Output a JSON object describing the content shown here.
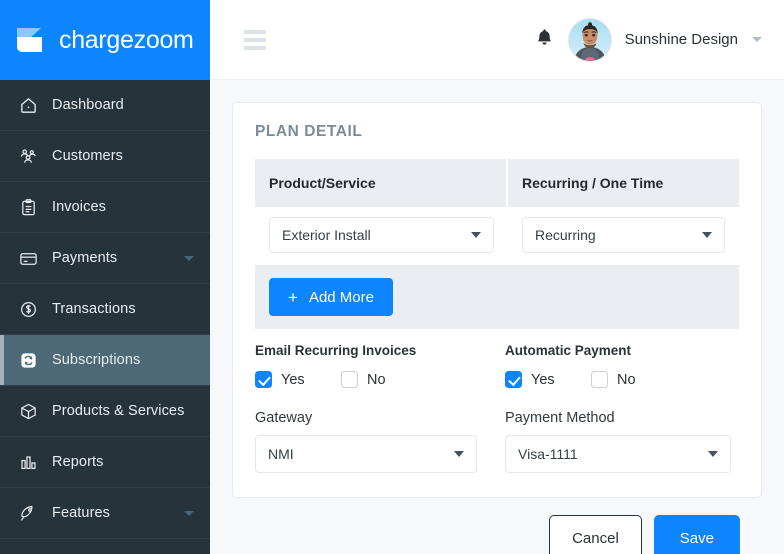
{
  "brand": {
    "name": "chargezoom",
    "logo_icon": "chargezoom-logo-icon",
    "bg_color": "#0d85fd"
  },
  "sidebar": {
    "bg_color": "#26333b",
    "active_bg_color": "#4d6876",
    "items": [
      {
        "label": "Dashboard",
        "icon": "home-icon",
        "active": false,
        "expandable": false
      },
      {
        "label": "Customers",
        "icon": "people-icon",
        "active": false,
        "expandable": false
      },
      {
        "label": "Invoices",
        "icon": "clipboard-icon",
        "active": false,
        "expandable": false
      },
      {
        "label": "Payments",
        "icon": "credit-card-icon",
        "active": false,
        "expandable": true
      },
      {
        "label": "Transactions",
        "icon": "dollar-circle-icon",
        "active": false,
        "expandable": false
      },
      {
        "label": "Subscriptions",
        "icon": "refresh-box-icon",
        "active": true,
        "expandable": false
      },
      {
        "label": "Products & Services",
        "icon": "box-icon",
        "active": false,
        "expandable": false
      },
      {
        "label": "Reports",
        "icon": "bar-chart-icon",
        "active": false,
        "expandable": false
      },
      {
        "label": "Features",
        "icon": "rocket-icon",
        "active": false,
        "expandable": true
      }
    ]
  },
  "topbar": {
    "menu_icon": "hamburger-menu-icon",
    "bell_icon": "notification-bell-icon",
    "avatar_icon": "user-avatar",
    "user_name": "Sunshine Design",
    "caret_icon": "chevron-down-icon"
  },
  "plan_detail": {
    "title": "PLAN DETAIL",
    "columns": [
      "Product/Service",
      "Recurring / One Time"
    ],
    "rows": [
      {
        "product": "Exterior Install",
        "recurring": "Recurring"
      }
    ],
    "add_more_label": "Add More",
    "add_more_icon": "plus-icon"
  },
  "options": {
    "email_recurring": {
      "label": "Email Recurring Invoices",
      "yes_label": "Yes",
      "no_label": "No",
      "yes_checked": true,
      "no_checked": false
    },
    "automatic_payment": {
      "label": "Automatic Payment",
      "yes_label": "Yes",
      "no_label": "No",
      "yes_checked": true,
      "no_checked": false
    }
  },
  "fields": {
    "gateway": {
      "label": "Gateway",
      "value": "NMI"
    },
    "payment_method": {
      "label": "Payment Method",
      "value": "Visa-1111"
    }
  },
  "actions": {
    "cancel_label": "Cancel",
    "save_label": "Save"
  },
  "colors": {
    "accent": "#0d85fd",
    "header_row": "#eaeef2",
    "page_bg": "#f7f8fb"
  }
}
